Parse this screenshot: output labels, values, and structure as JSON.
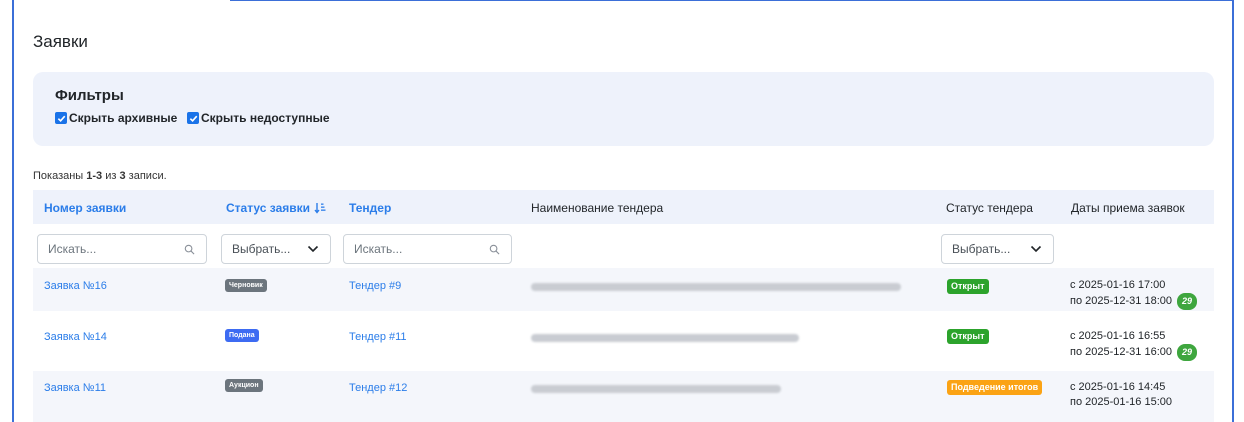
{
  "page": {
    "title": "Заявки"
  },
  "filters": {
    "title": "Фильтры",
    "hide_archived": "Скрыть архивные",
    "hide_unavailable": "Скрыть недоступные"
  },
  "summary": {
    "prefix": "Показаны ",
    "range": "1-3",
    "middle": " из ",
    "total": "3",
    "suffix": " записи."
  },
  "table": {
    "columns": {
      "application_number": "Номер заявки",
      "application_status": "Статус заявки",
      "tender": "Тендер",
      "tender_name": "Наименование тендера",
      "tender_status": "Статус тендера",
      "dates": "Даты приема заявок"
    },
    "filter_inputs": {
      "search_placeholder": "Искать...",
      "select_placeholder": "Выбрать..."
    },
    "rows": [
      {
        "number": "Заявка №16",
        "status": "Черновик",
        "tender": "Тендер #9",
        "tender_status": "Открыт",
        "date_from": "с 2025-01-16 17:00",
        "date_to": "по 2025-12-31 18:00",
        "days_left": "29"
      },
      {
        "number": "Заявка №14",
        "status": "Подана",
        "tender": "Тендер #11",
        "tender_status": "Открыт",
        "date_from": "с 2025-01-16 16:55",
        "date_to": "по 2025-12-31 16:00",
        "days_left": "29"
      },
      {
        "number": "Заявка №11",
        "status": "Аукцион",
        "tender": "Тендер #12",
        "tender_status": "Подведение итогов",
        "date_from": "с 2025-01-16 14:45",
        "date_to": "по 2025-01-16 15:00"
      }
    ]
  },
  "colors": {
    "accent": "#2b7de9",
    "draft": "#6c757d",
    "submitted": "#3d6bf2",
    "open": "#2ca32c",
    "summarizing": "#fba314"
  }
}
